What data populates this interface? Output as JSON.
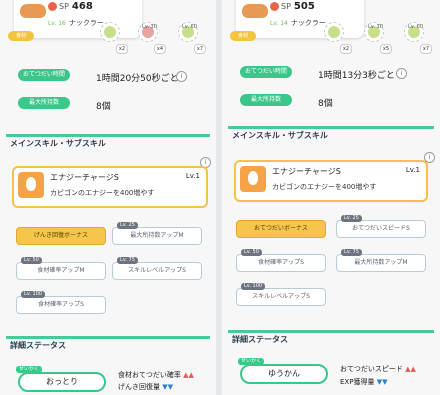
{
  "left": {
    "sp_label": "SP",
    "sp_value": "468",
    "level": "Lv. 16",
    "name": "ナックラー",
    "food_label": "食材",
    "berry_levels": [
      "Lv. 30",
      "Lv. 60"
    ],
    "multipliers": [
      "x2",
      "x4",
      "x7"
    ],
    "help_label": "おてつだい時間",
    "help_value": "1時間20分50秒ごと",
    "inventory_label": "最大所持数",
    "inventory_value": "8個",
    "skill_section": "メインスキル・サブスキル",
    "skill_name": "エナジーチャージS",
    "skill_level": "Lv.1",
    "skill_desc": "カビゴンのエナジーを400増やす",
    "subskills": [
      {
        "badge": "",
        "label": "げんき回復ボーナス",
        "active": true
      },
      {
        "badge": "Lv. 25",
        "label": "最大所持数アップM",
        "active": false
      },
      {
        "badge": "Lv. 50",
        "label": "食材確率アップM",
        "active": false
      },
      {
        "badge": "Lv. 75",
        "label": "スキルレベルアップS",
        "active": false
      },
      {
        "badge": "Lv. 100",
        "label": "食材確率アップS",
        "active": false
      }
    ],
    "detail_section": "詳細ステータス",
    "nature_badge": "せいかく",
    "nature": "おっとり",
    "effect_up": "食材おてつだい確率",
    "effect_down": "げんき回復量",
    "up_arrows": "▲▲",
    "down_arrows": "▼▼"
  },
  "right": {
    "sp_label": "SP",
    "sp_value": "505",
    "level": "Lv. 14",
    "name": "ナックラー",
    "food_label": "食材",
    "berry_levels": [
      "Lv. 30",
      "Lv. 60"
    ],
    "multipliers": [
      "x2",
      "x5",
      "x7"
    ],
    "help_label": "おてつだい時間",
    "help_value": "1時間13分3秒ごと",
    "inventory_label": "最大所持数",
    "inventory_value": "8個",
    "skill_section": "メインスキル・サブスキル",
    "skill_name": "エナジーチャージS",
    "skill_level": "Lv.1",
    "skill_desc": "カビゴンのエナジーを400増やす",
    "subskills": [
      {
        "badge": "",
        "label": "おてつだいボーナス",
        "active": true
      },
      {
        "badge": "Lv. 25",
        "label": "おてつだいスピードS",
        "active": false
      },
      {
        "badge": "Lv. 50",
        "label": "食材確率アップS",
        "active": false
      },
      {
        "badge": "Lv. 75",
        "label": "最大所持数アップM",
        "active": false
      },
      {
        "badge": "Lv. 100",
        "label": "スキルレベルアップS",
        "active": false
      }
    ],
    "detail_section": "詳細ステータス",
    "nature_badge": "せいかく",
    "nature": "ゆうかん",
    "effect_up": "おてつだいスピード",
    "effect_down": "EXP獲得量",
    "up_arrows": "▲▲",
    "down_arrows": "▼▼"
  },
  "colors": {
    "green": "#3bc68a",
    "gold": "#f6c04b",
    "up": "#e9575c",
    "down": "#2c7fc9"
  }
}
